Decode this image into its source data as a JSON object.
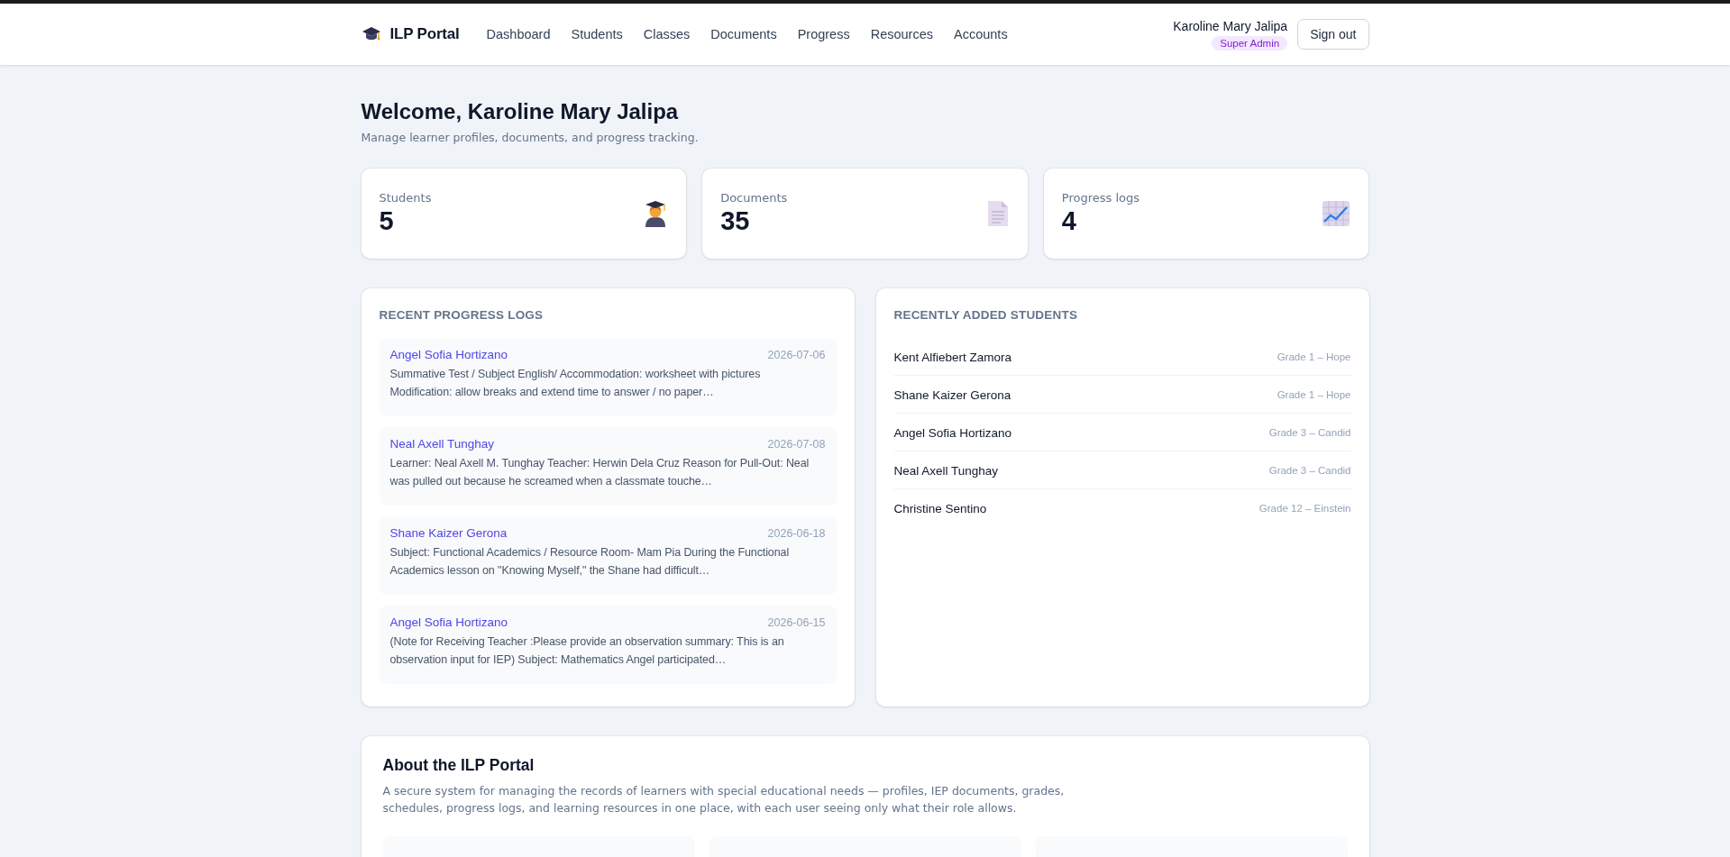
{
  "header": {
    "brand": "ILP Portal",
    "nav": [
      {
        "label": "Dashboard",
        "selected": false
      },
      {
        "label": "Students",
        "selected": false
      },
      {
        "label": "Classes",
        "selected": false
      },
      {
        "label": "Documents",
        "selected": false
      },
      {
        "label": "Progress",
        "selected": false
      },
      {
        "label": "Resources",
        "selected": false
      },
      {
        "label": "Accounts",
        "selected": false
      }
    ],
    "user_name": "Karoline Mary Jalipa",
    "role_badge": "Super Admin",
    "sign_out": "Sign out"
  },
  "welcome": {
    "title": "Welcome, Karoline Mary Jalipa",
    "subtitle": "Manage learner profiles, documents, and progress tracking."
  },
  "stats": [
    {
      "label": "Students",
      "value": "5",
      "kind": "graduate"
    },
    {
      "label": "Documents",
      "value": "35",
      "kind": "document"
    },
    {
      "label": "Progress logs",
      "value": "4",
      "kind": "chart"
    }
  ],
  "recent_progress_logs": {
    "title": "RECENT PROGRESS LOGS",
    "items": [
      {
        "student": "Angel Sofia Hortizano",
        "date": "2026-07-06",
        "text": "Summative Test / Subject English/ Accommodation: worksheet with pictures Modification: allow breaks and extend time to answer / no paper…"
      },
      {
        "student": "Neal Axell Tunghay",
        "date": "2026-07-08",
        "text": "Learner: Neal Axell M. Tunghay Teacher: Herwin Dela Cruz  Reason for Pull-Out: Neal was pulled out because he screamed when a classmate touche…"
      },
      {
        "student": "Shane Kaizer Gerona",
        "date": "2026-06-18",
        "text": "Subject: Functional Academics / Resource Room- Mam Pia   During the Functional Academics lesson on \"Knowing Myself,\" the Shane had difficult…"
      },
      {
        "student": "Angel Sofia Hortizano",
        "date": "2026-06-15",
        "text": "(Note for Receiving Teacher :Please provide an observation summary: This is an observation input for IEP)   Subject: Mathematics  Angel participated…"
      }
    ]
  },
  "recently_added_students": {
    "title": "RECENTLY ADDED STUDENTS",
    "items": [
      {
        "name": "Kent Alfiebert Zamora",
        "class": "Grade 1 – Hope"
      },
      {
        "name": "Shane Kaizer Gerona",
        "class": "Grade 1 – Hope"
      },
      {
        "name": "Angel Sofia Hortizano",
        "class": "Grade 3 – Candid"
      },
      {
        "name": "Neal Axell Tunghay",
        "class": "Grade 3 – Candid"
      },
      {
        "name": "Christine Sentino",
        "class": "Grade 12 – Einstein"
      }
    ]
  },
  "about": {
    "title": "About the ILP Portal",
    "text": "A secure system for managing the records of learners with special educational needs — profiles, IEP documents, grades, schedules, progress logs, and learning resources in one place, with each user seeing only what their role allows."
  }
}
